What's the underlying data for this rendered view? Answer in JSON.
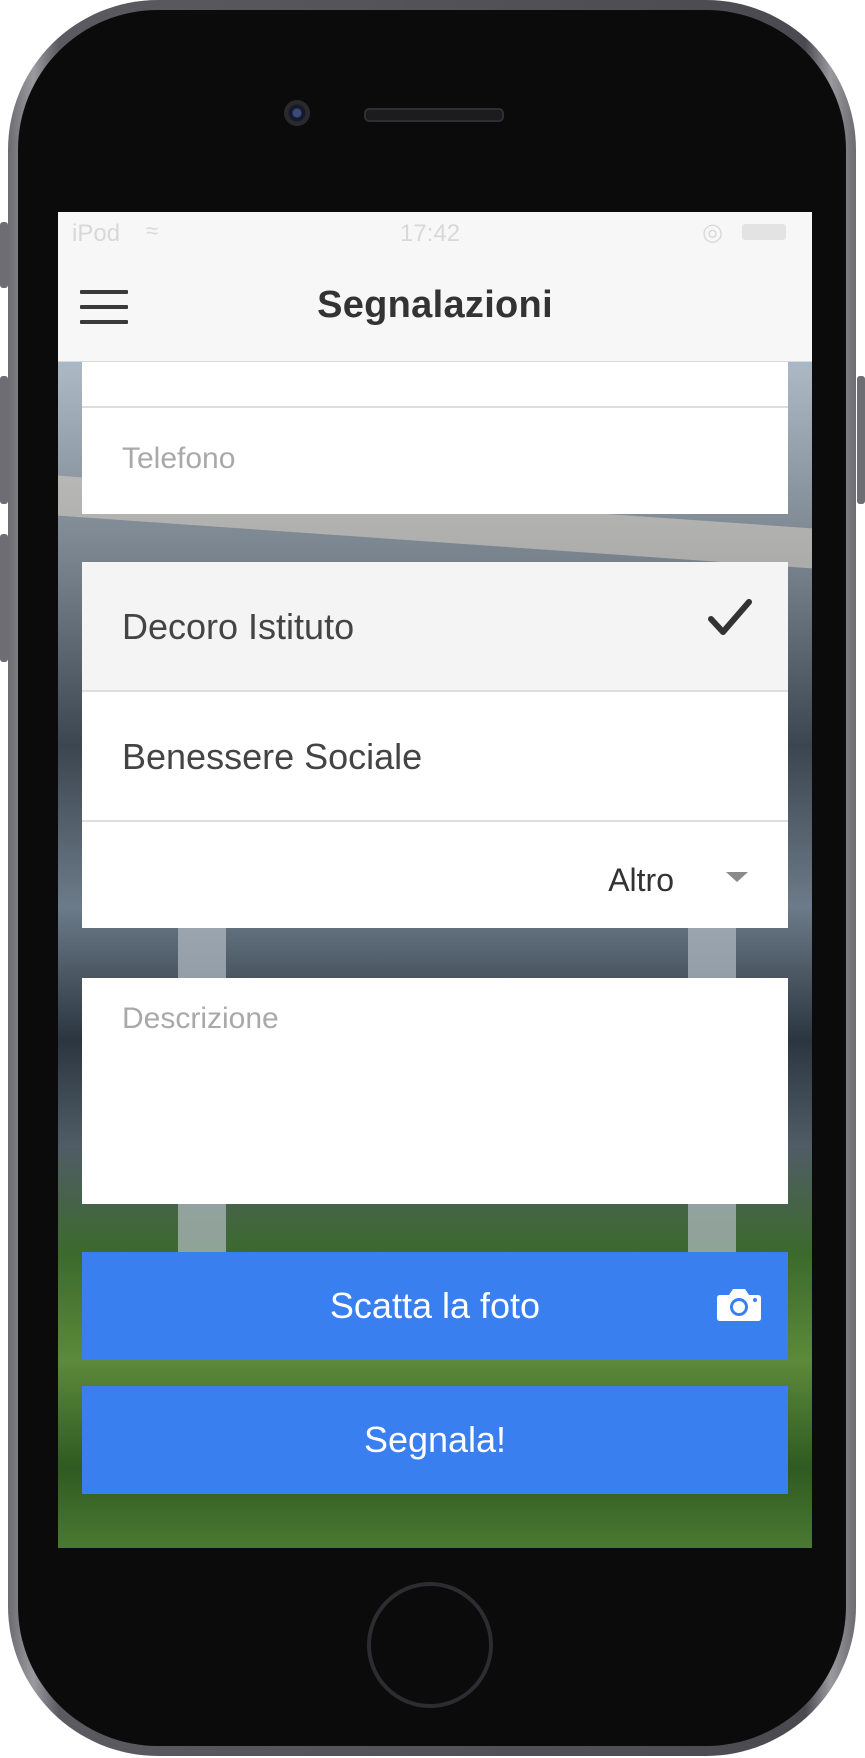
{
  "status_bar": {
    "carrier": "iPod",
    "time": "17:42"
  },
  "header": {
    "title": "Segnalazioni"
  },
  "form": {
    "phone_placeholder": "Telefono",
    "categories": [
      {
        "label": "Decoro Istituto",
        "selected": true
      },
      {
        "label": "Benessere Sociale",
        "selected": false
      }
    ],
    "other_select": {
      "value": "Altro"
    },
    "description_placeholder": "Descrizione",
    "photo_button": "Scatta la foto",
    "submit_button": "Segnala!"
  },
  "icons": {
    "menu": "hamburger-icon",
    "check": "checkmark-icon",
    "caret": "chevron-down-icon",
    "camera": "camera-icon"
  },
  "colors": {
    "primary": "#3a7ff0",
    "header_bg": "#f7f7f7",
    "text": "#333333",
    "placeholder": "#a9a9a9"
  }
}
